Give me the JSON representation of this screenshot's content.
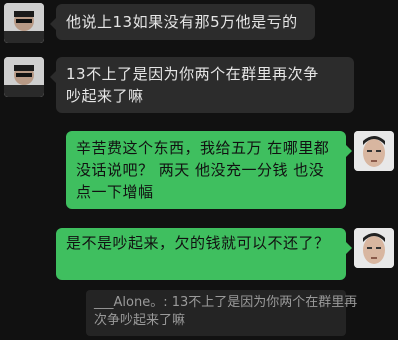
{
  "messages": [
    {
      "side": "in",
      "lines": [
        "他说上13如果没有那5万他是亏的"
      ]
    },
    {
      "side": "in",
      "lines": [
        "13不上了是因为你两个在群里再次争",
        "吵起来了嘛"
      ]
    },
    {
      "side": "out",
      "lines": [
        "辛苦费这个东西，我给五万 在哪里都",
        "没话说吧？ 两天 他没充一分钱 也没",
        "点一下增幅"
      ]
    },
    {
      "side": "out",
      "lines": [
        "是不是吵起来，欠的钱就可以不还了？"
      ]
    }
  ],
  "quote": {
    "lines": [
      "___Alone。: 13不上了是因为你两个在群里再",
      "次争吵起来了嘛"
    ]
  },
  "colors": {
    "background": "#111111",
    "incoming_bubble": "#2c2c2c",
    "outgoing_bubble": "#3fbf5f",
    "quote_bg": "#242424"
  }
}
